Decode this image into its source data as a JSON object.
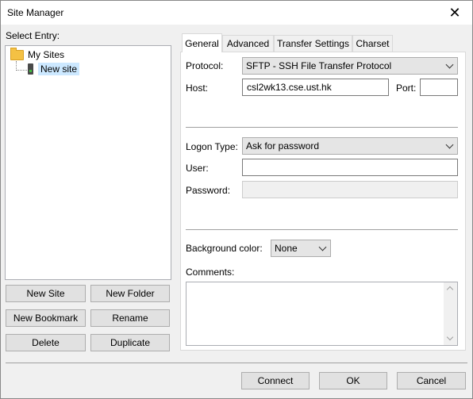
{
  "window": {
    "title": "Site Manager",
    "close_glyph": "✕"
  },
  "left": {
    "select_entry_label": "Select Entry:",
    "tree": {
      "root_label": "My Sites",
      "child_label": "New site"
    },
    "buttons": {
      "new_site": "New Site",
      "new_folder": "New Folder",
      "new_bookmark": "New Bookmark",
      "rename": "Rename",
      "delete": "Delete",
      "duplicate": "Duplicate"
    }
  },
  "tabs": [
    "General",
    "Advanced",
    "Transfer Settings",
    "Charset"
  ],
  "general": {
    "protocol_label": "Protocol:",
    "protocol_value": "SFTP - SSH File Transfer Protocol",
    "host_label": "Host:",
    "host_value": "csl2wk13.cse.ust.hk",
    "port_label": "Port:",
    "port_value": "",
    "logon_type_label": "Logon Type:",
    "logon_type_value": "Ask for password",
    "user_label": "User:",
    "user_value": "",
    "password_label": "Password:",
    "password_value": "",
    "background_color_label": "Background color:",
    "background_color_value": "None",
    "comments_label": "Comments:",
    "comments_value": ""
  },
  "footer": {
    "connect": "Connect",
    "ok": "OK",
    "cancel": "Cancel"
  },
  "icons": {
    "root": "folder-icon",
    "child": "server-icon"
  }
}
